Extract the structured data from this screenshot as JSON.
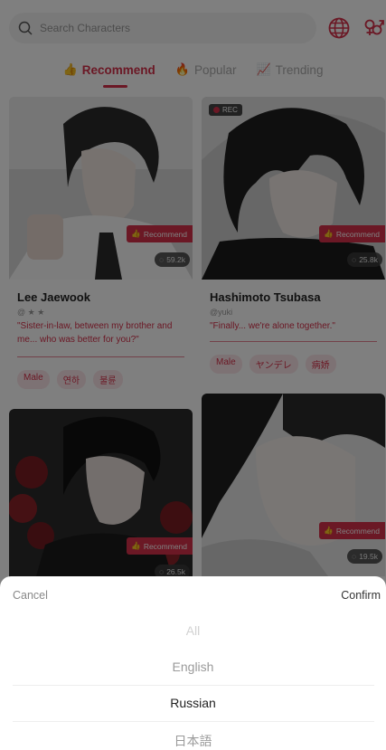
{
  "search": {
    "placeholder": "Search Characters"
  },
  "header": {
    "language_icon": "globe-icon",
    "gender_icon": "gender-icon"
  },
  "tabs": [
    {
      "label": "Recommend",
      "icon": "thumbs-up-icon",
      "active": true
    },
    {
      "label": "Popular",
      "icon": "fire-icon",
      "active": false
    },
    {
      "label": "Trending",
      "icon": "trending-chart-icon",
      "active": false
    }
  ],
  "badge": {
    "recommend": "Recommend",
    "rec": "REC"
  },
  "cards": [
    {
      "name": "Lee Jaewook",
      "author": "@ ★ ★",
      "quote": "\"Sister-in-law, between my brother and me... who was better for you?\"",
      "views": "59.2k",
      "tags": [
        "Male",
        "연하",
        "불륜"
      ]
    },
    {
      "name": "Hashimoto Tsubasa",
      "author": "@yuki",
      "quote": "\"Finally... we're alone together.\"",
      "views": "25.8k",
      "tags": [
        "Male",
        "ヤンデレ",
        "病娇"
      ]
    },
    {
      "views": "26.5k"
    },
    {
      "views": "19.5k"
    }
  ],
  "picker": {
    "cancel": "Cancel",
    "confirm": "Confirm",
    "options": [
      "All",
      "English",
      "Russian",
      "日本語"
    ],
    "selected": "Russian"
  },
  "colors": {
    "accent": "#d6304a",
    "overlay": "rgba(0,0,0,0.5)"
  }
}
